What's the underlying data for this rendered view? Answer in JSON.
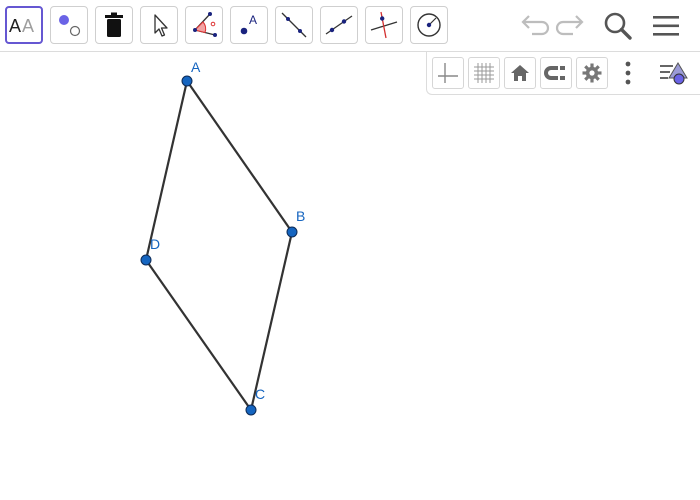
{
  "toolbar": {
    "tools": [
      {
        "id": "style",
        "icon": "text-style-icon",
        "label": "AA"
      },
      {
        "id": "show-hide",
        "icon": "show-hide-object-icon"
      },
      {
        "id": "delete",
        "icon": "trash-icon"
      },
      {
        "id": "move",
        "icon": "move-arrow-icon"
      },
      {
        "id": "angle",
        "icon": "angle-icon"
      },
      {
        "id": "point",
        "icon": "point-icon",
        "label": "A"
      },
      {
        "id": "line",
        "icon": "line-icon"
      },
      {
        "id": "segment",
        "icon": "segment-icon"
      },
      {
        "id": "perpendicular",
        "icon": "perpendicular-line-icon"
      },
      {
        "id": "circle",
        "icon": "circle-icon"
      }
    ],
    "right": [
      "undo-icon",
      "redo-icon",
      "search-icon",
      "menu-icon"
    ]
  },
  "graphics_bar": {
    "buttons": [
      "axes-icon",
      "grid-icon",
      "home-icon",
      "snap-magnet-icon",
      "settings-gear-icon",
      "more-vertical-icon",
      "algebra-style-icon"
    ]
  },
  "points": [
    {
      "name": "A"
    },
    {
      "name": "B"
    },
    {
      "name": "C"
    },
    {
      "name": "D"
    }
  ],
  "polygon": {
    "vertices": [
      "A",
      "B",
      "C",
      "D"
    ],
    "edge_color": "#333333",
    "point_color": "#1565c0"
  },
  "colors": {
    "accent": "#6557d2",
    "point_fill": "#1565c0",
    "label": "#1565c0"
  }
}
